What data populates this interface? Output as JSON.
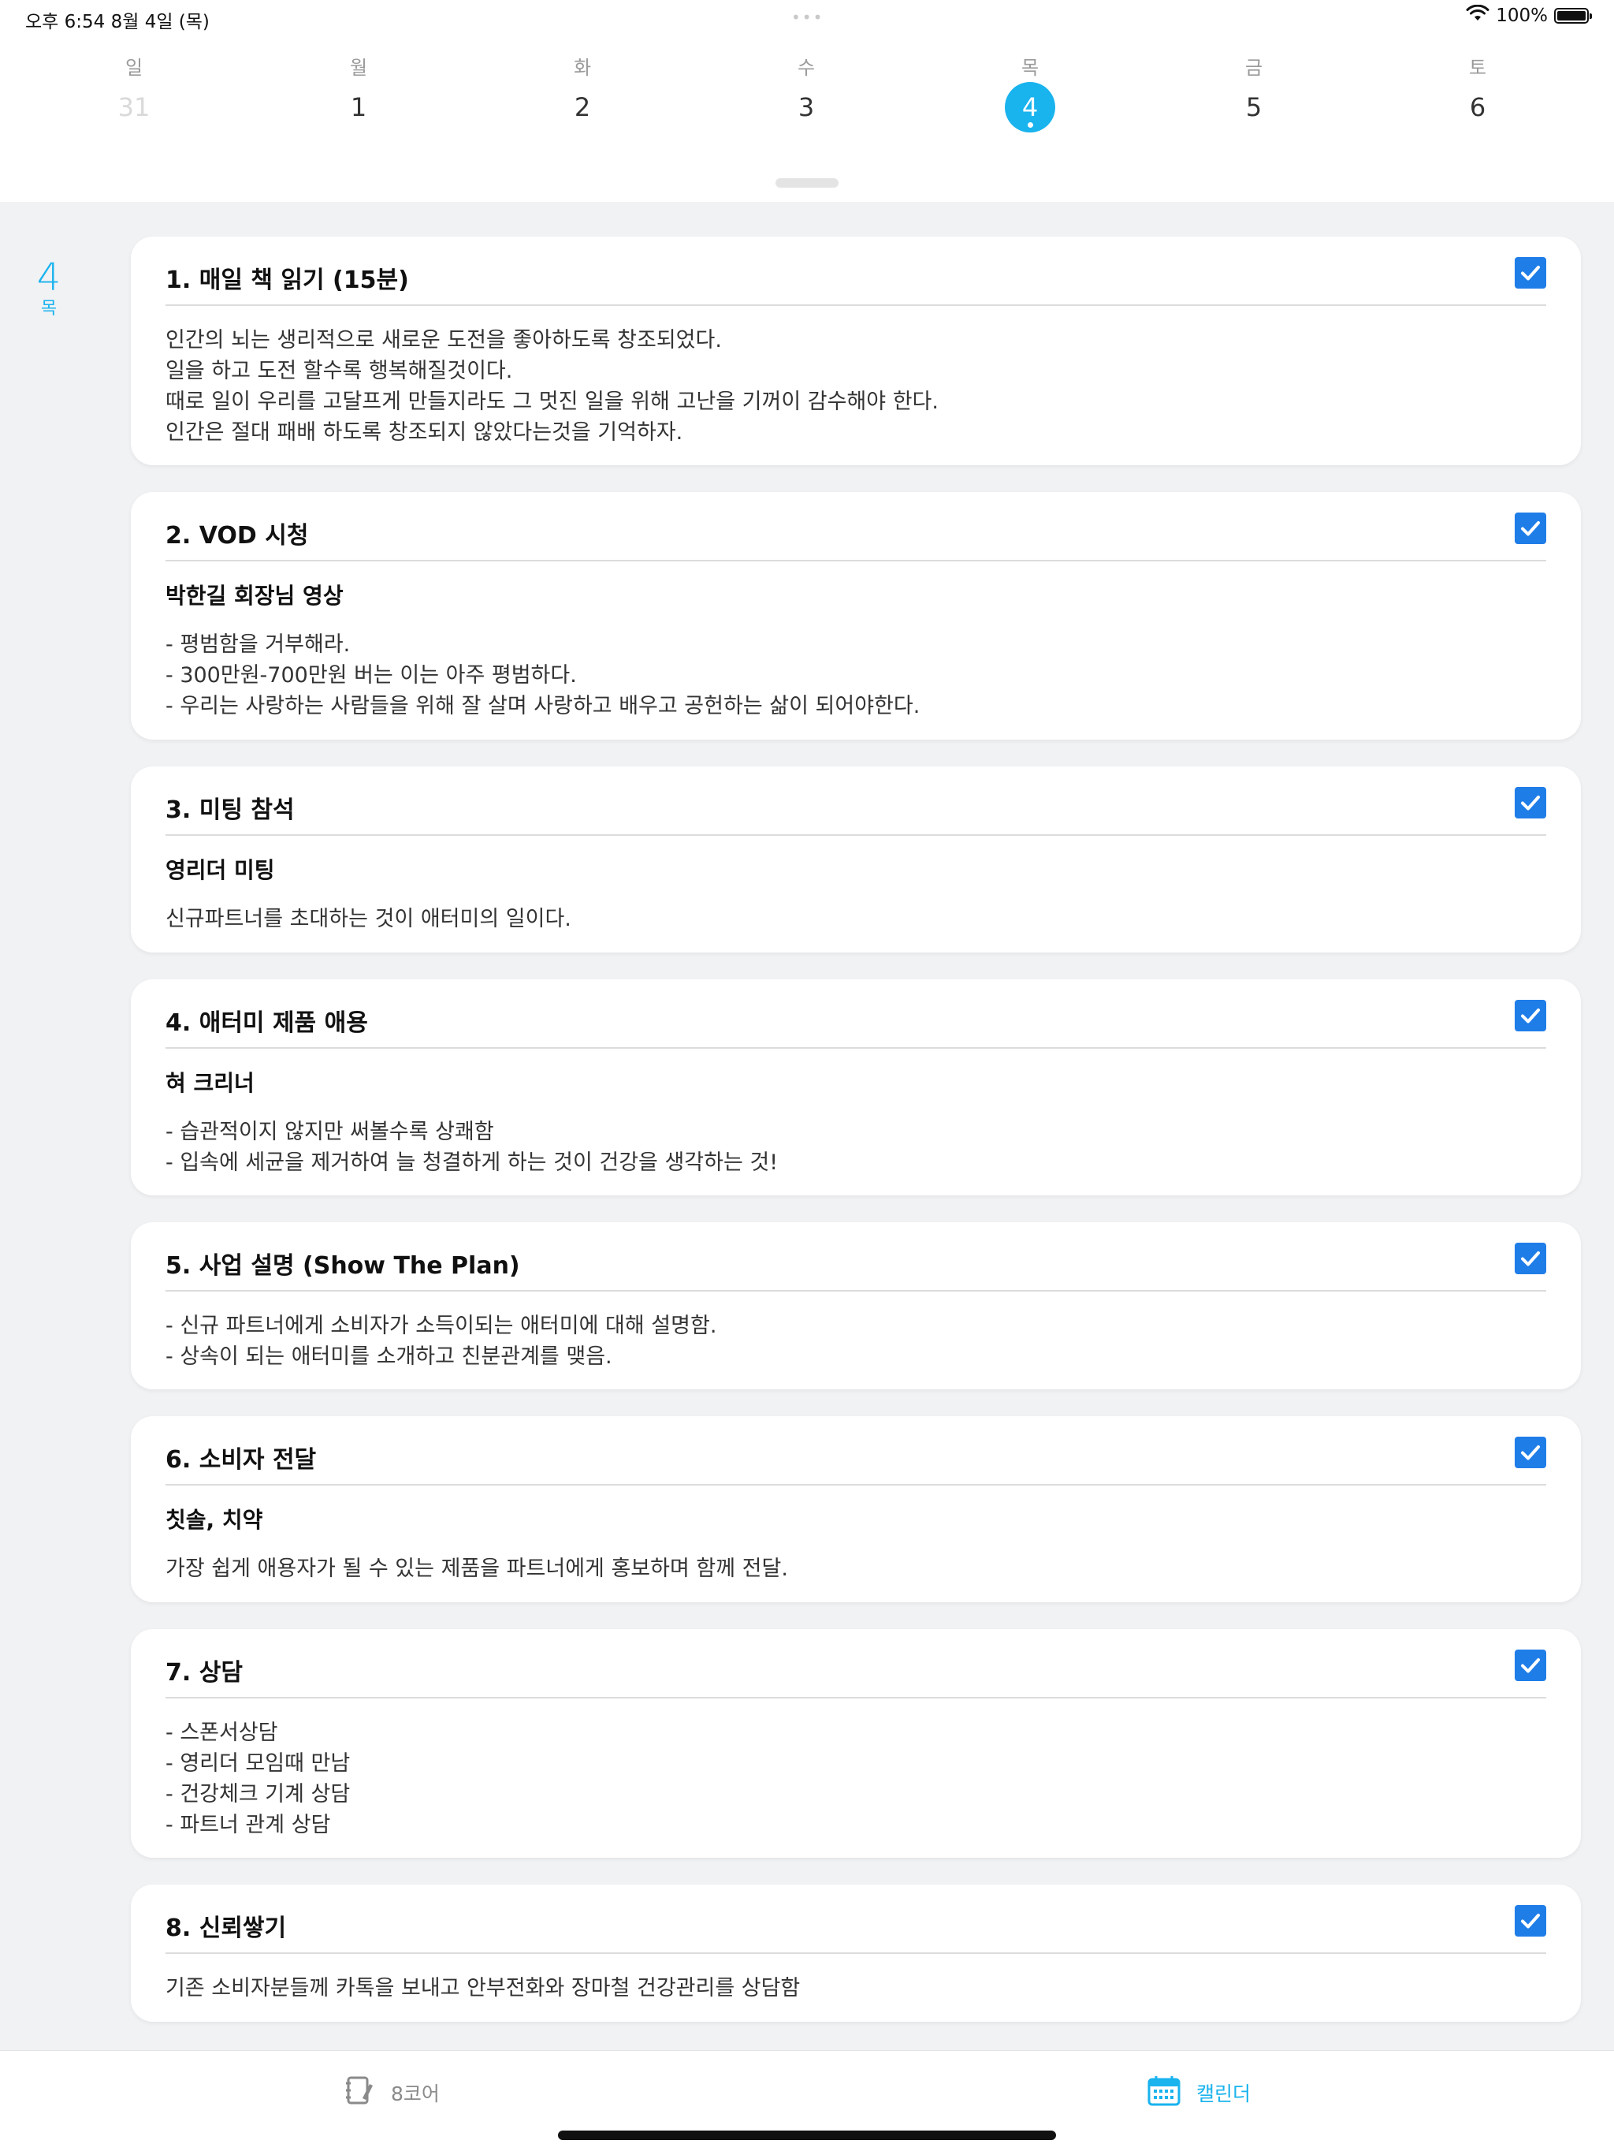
{
  "status": {
    "time": "오후 6:54   8월 4일 (목)",
    "dots": "•••",
    "battery": "100%"
  },
  "week": [
    {
      "name": "일",
      "num": "31",
      "state": "faded"
    },
    {
      "name": "월",
      "num": "1",
      "state": "normal"
    },
    {
      "name": "화",
      "num": "2",
      "state": "normal"
    },
    {
      "name": "수",
      "num": "3",
      "state": "normal"
    },
    {
      "name": "목",
      "num": "4",
      "state": "selected"
    },
    {
      "name": "금",
      "num": "5",
      "state": "normal"
    },
    {
      "name": "토",
      "num": "6",
      "state": "normal"
    }
  ],
  "selected_date": {
    "num": "4",
    "name": "목"
  },
  "cards": [
    {
      "title": "1. 매일 책 읽기 (15분)",
      "checked": true,
      "subtitle": "",
      "lines": [
        "인간의 뇌는 생리적으로 새로운 도전을 좋아하도록 창조되었다.",
        "일을 하고 도전 할수록 행복해질것이다.",
        "때로 일이 우리를 고달프게 만들지라도 그 멋진 일을 위해 고난을 기꺼이 감수해야 한다.",
        "인간은 절대 패배 하도록 창조되지 않았다는것을 기억하자."
      ]
    },
    {
      "title": "2. VOD 시청",
      "checked": true,
      "subtitle": "박한길 회장님 영상",
      "lines": [
        "- 평범함을 거부해라.",
        "- 300만원-700만원 버는 이는 아주 평범하다.",
        "- 우리는 사랑하는 사람들을 위해 잘 살며 사랑하고 배우고 공헌하는 삶이 되어야한다."
      ]
    },
    {
      "title": "3. 미팅 참석",
      "checked": true,
      "subtitle": "영리더 미팅",
      "lines": [
        "신규파트너를 초대하는 것이 애터미의 일이다."
      ]
    },
    {
      "title": "4. 애터미 제품 애용",
      "checked": true,
      "subtitle": "혀 크리너",
      "lines": [
        "- 습관적이지 않지만 써볼수록 상쾌함",
        "- 입속에 세균을 제거하여 늘 청결하게 하는 것이 건강을 생각하는 것!"
      ]
    },
    {
      "title": "5. 사업 설명 (Show The Plan)",
      "checked": true,
      "subtitle": "",
      "lines": [
        "- 신규 파트너에게 소비자가 소득이되는 애터미에 대해 설명함.",
        "- 상속이 되는 애터미를 소개하고 친분관계를 맺음."
      ]
    },
    {
      "title": "6. 소비자 전달",
      "checked": true,
      "subtitle": "칫솔, 치약",
      "lines": [
        "가장 쉽게 애용자가 될 수 있는 제품을 파트너에게 홍보하며 함께 전달."
      ]
    },
    {
      "title": "7. 상담",
      "checked": true,
      "subtitle": "",
      "lines": [
        "- 스폰서상담",
        "- 영리더 모임때 만남",
        "- 건강체크 기계 상담",
        "- 파트너 관계 상담"
      ]
    },
    {
      "title": "8. 신뢰쌓기",
      "checked": true,
      "subtitle": "",
      "lines": [
        "기존 소비자분들께 카톡을 보내고 안부전화와 장마철 건강관리를 상담함"
      ]
    }
  ],
  "tabs": {
    "core": "8코어",
    "calendar": "캘린더"
  },
  "colors": {
    "accent": "#19b3ee",
    "checkbox": "#1f7de8"
  },
  "icons": {
    "wifi": "wifi-icon",
    "battery": "battery-icon",
    "core": "notebook-icon",
    "calendar": "calendar-icon",
    "check": "checkmark-icon"
  }
}
